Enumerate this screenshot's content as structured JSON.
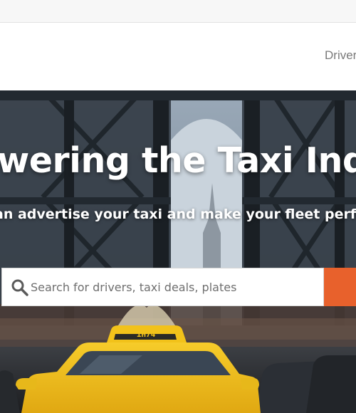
{
  "header": {
    "nav_drivers": "Driver"
  },
  "hero": {
    "title": "wering the Taxi Indu",
    "subtitle": "an advertise your taxi and make your fleet perform b"
  },
  "search": {
    "placeholder": "Search for drivers, taxi deals, plates",
    "value": "",
    "button_color": "#e8612c"
  },
  "taxi_roof_sign": "1H74",
  "colors": {
    "accent": "#e8612c",
    "taxi_yellow": "#f2c21a"
  }
}
